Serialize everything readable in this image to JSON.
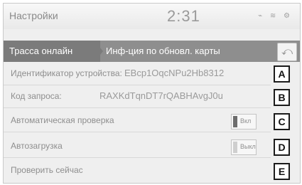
{
  "header": {
    "title": "Настройки",
    "clock": "2:31",
    "status_icons": "⌁ ≋ ⚙"
  },
  "breadcrumb": {
    "items": [
      "Трасса онлайн",
      "Инф-ция по обновл. карты"
    ],
    "back_icon": "⤺"
  },
  "rows": [
    {
      "label": "Идентификатор устройства:",
      "value": "EBcp1OqcNPu2Hb8312",
      "callout": "A"
    },
    {
      "label": "Код запроса:",
      "value": "RAXKdTqnDT7rQABHAvgJ0u",
      "callout": "B"
    },
    {
      "label": "Автоматическая проверка",
      "toggle": "Вкл",
      "callout": "C"
    },
    {
      "label": "Автозагрузка",
      "toggle": "Выкл",
      "callout": "D"
    },
    {
      "label": "Проверить сейчас",
      "callout": "E"
    }
  ]
}
